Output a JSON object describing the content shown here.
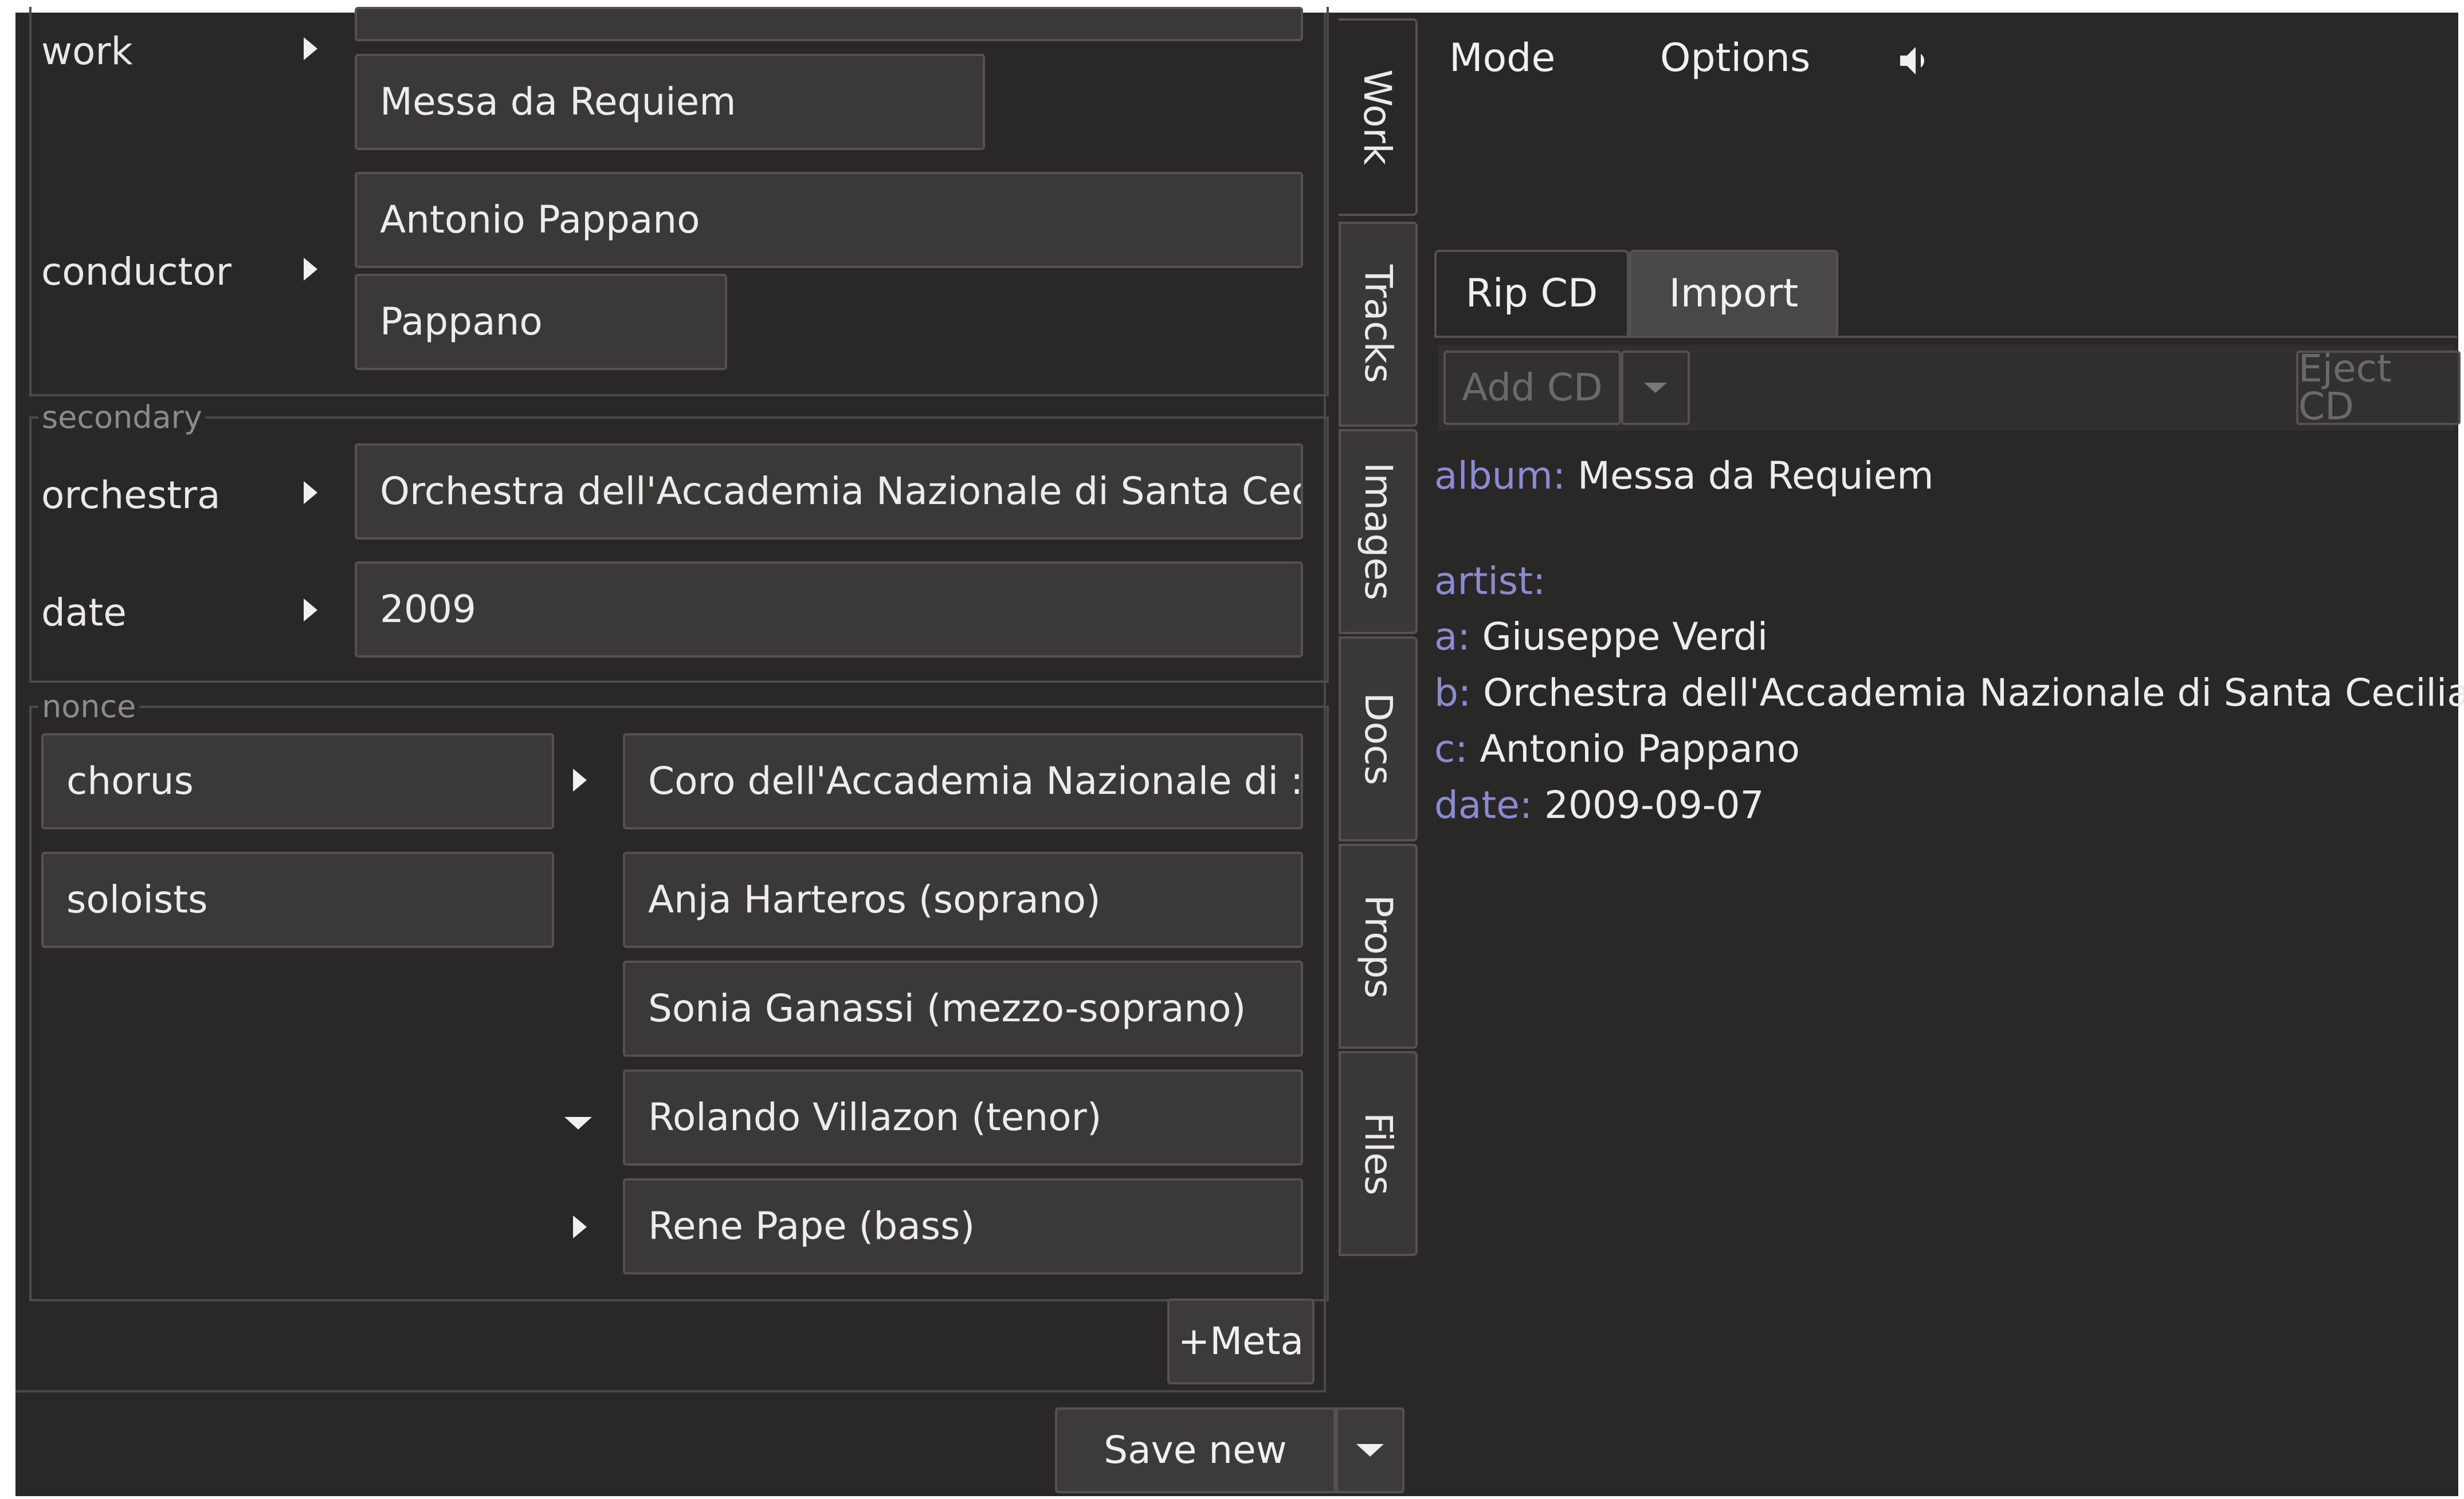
{
  "editor": {
    "primary": {
      "work": {
        "label": "work",
        "values": [
          "Messa da Requiem"
        ]
      },
      "conductor": {
        "label": "conductor",
        "values": [
          "Antonio Pappano",
          "Pappano"
        ]
      }
    },
    "secondary": {
      "legend": "secondary",
      "orchestra": {
        "label": "orchestra",
        "value": "Orchestra dell'Accademia Nazionale di  Santa Cecil"
      },
      "date": {
        "label": "date",
        "value": "2009"
      }
    },
    "nonce": {
      "legend": "nonce",
      "chorus": {
        "label": "chorus",
        "value": "Coro  dell'Accademia Nazionale di :"
      },
      "soloists": {
        "label": "soloists",
        "values": [
          "Anja Harteros (soprano)",
          "Sonia Ganassi (mezzo-soprano)",
          "Rolando Villazon (tenor)",
          "Rene Pape (bass)"
        ]
      }
    },
    "meta_button": "+Meta",
    "save_button": "Save new"
  },
  "vtabs": [
    "Work",
    "Tracks",
    "Images",
    "Docs",
    "Props",
    "Files"
  ],
  "right": {
    "menu": {
      "mode": "Mode",
      "options": "Options"
    },
    "tabs": [
      "Rip CD",
      "Import"
    ],
    "toolbar": {
      "add_cd": "Add CD",
      "eject_cd": "Eject CD"
    },
    "info": {
      "album_key": "album:",
      "album_val": "Messa da Requiem",
      "artist_key": "artist:",
      "a_key": "a:",
      "a_val": "Giuseppe Verdi",
      "b_key": "b:",
      "b_val": "Orchestra dell'Accademia Nazionale di Santa Cecilia",
      "c_key": "c:",
      "c_val": "Antonio Pappano",
      "date_key": "date:",
      "date_val": "2009-09-07"
    }
  },
  "colors": {
    "background": "#2a2727",
    "field": "#3b3838",
    "key_text": "#8a8bd2"
  }
}
